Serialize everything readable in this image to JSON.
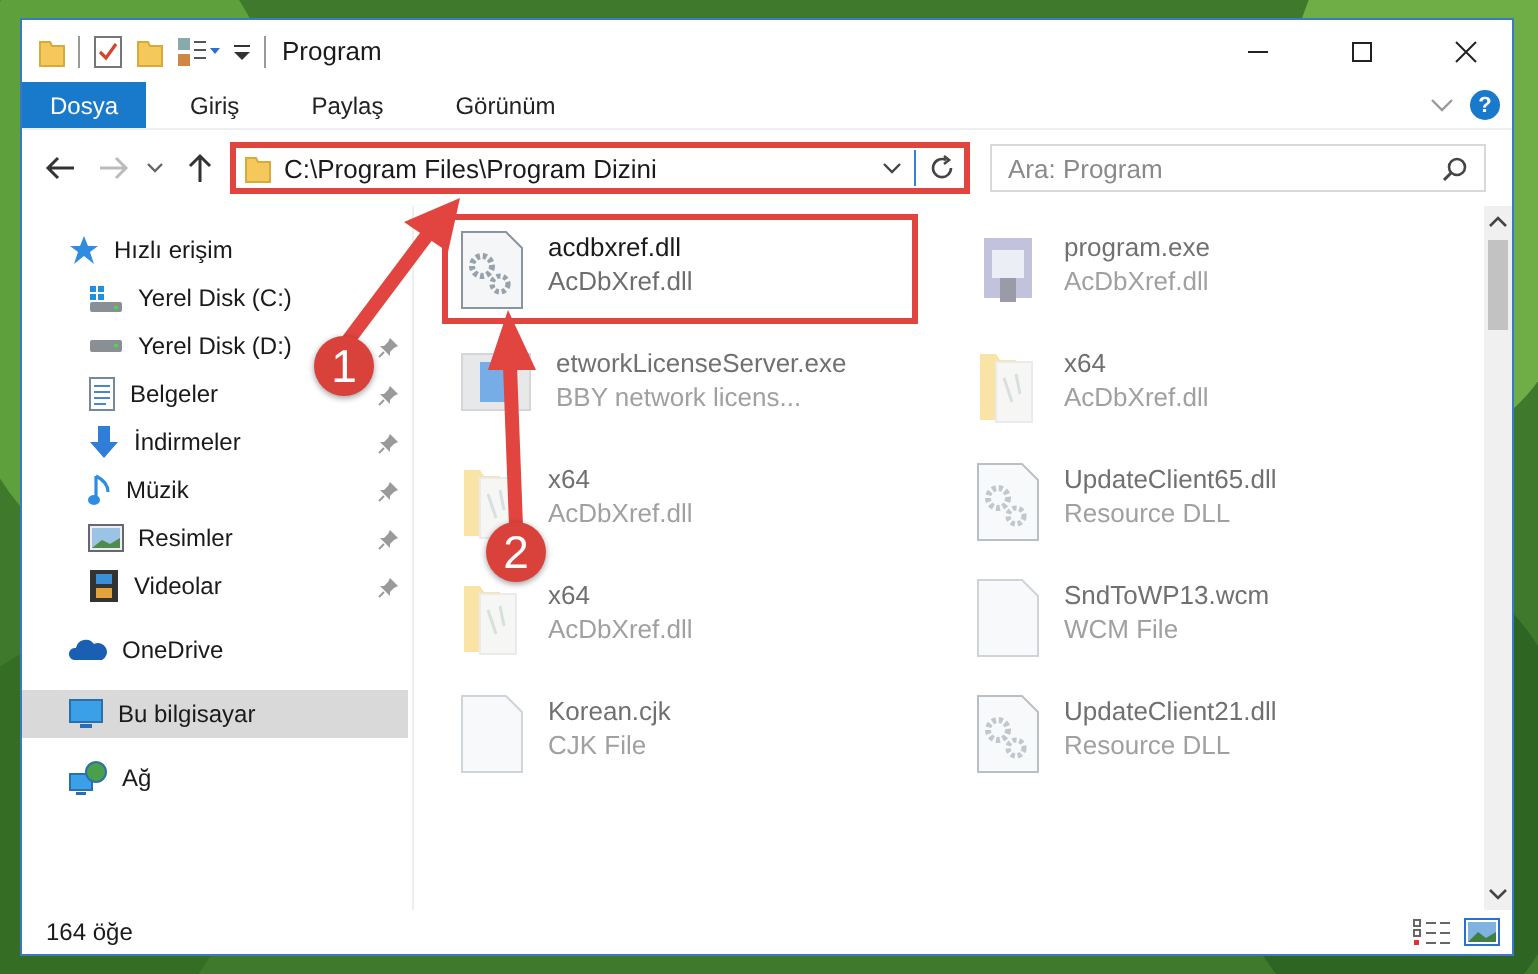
{
  "window": {
    "title": "Program"
  },
  "ribbon_tabs": [
    {
      "label": "Dosya",
      "selected": true
    },
    {
      "label": "Giriş",
      "selected": false
    },
    {
      "label": "Paylaş",
      "selected": false
    },
    {
      "label": "Görünüm",
      "selected": false
    }
  ],
  "help": "?",
  "address": {
    "path": "C:\\Program Files\\Program Dizini",
    "highlighted": true
  },
  "search": {
    "placeholder": "Ara: Program"
  },
  "navigation": [
    {
      "label": "Hızlı erişim",
      "kind": "star",
      "selected": false,
      "children": [
        {
          "label": "Yerel Disk (C:)",
          "kind": "windows-drive",
          "pinned": false,
          "selected": false
        },
        {
          "label": "Yerel Disk (D:)",
          "kind": "drive",
          "pinned": true,
          "selected": false
        },
        {
          "label": "Belgeler",
          "kind": "document",
          "pinned": true,
          "selected": false
        },
        {
          "label": "İndirmeler",
          "kind": "download",
          "pinned": true,
          "selected": false
        },
        {
          "label": "Müzik",
          "kind": "music",
          "pinned": true,
          "selected": false
        },
        {
          "label": "Resimler",
          "pinned": true,
          "selected": false
        },
        {
          "label": "Videolar",
          "kind": "film",
          "pinned": true,
          "selected": false
        }
      ]
    },
    {
      "label": "OneDrive",
      "kind": "cloud",
      "selected": false
    },
    {
      "label": "Bu bilgisayar",
      "kind": "monitor",
      "selected": true
    },
    {
      "label": "Ağ",
      "kind": "network",
      "selected": false
    }
  ],
  "files": [
    {
      "name": "acdbxref.dll",
      "type": "AcDbXref.dll",
      "kind": "gear-file",
      "highlighted": true,
      "faded": false
    },
    {
      "name": "program.exe",
      "type": "AcDbXref.dll",
      "kind": "program",
      "highlighted": false,
      "faded": true
    },
    {
      "name": "etworkLicenseServer.exe",
      "type": "BBY network licens...",
      "kind": "window-app",
      "highlighted": false,
      "faded": true
    },
    {
      "name": "x64",
      "type": "AcDbXref.dll",
      "kind": "folder",
      "highlighted": false,
      "faded": true
    },
    {
      "name": "x64",
      "type": "AcDbXref.dll",
      "kind": "folder",
      "highlighted": false,
      "faded": true
    },
    {
      "name": "UpdateClient65.dll",
      "type": "Resource DLL",
      "kind": "gear-file",
      "highlighted": false,
      "faded": true
    },
    {
      "name": "x64",
      "type": "AcDbXref.dll",
      "kind": "folder",
      "highlighted": false,
      "faded": true
    },
    {
      "name": "SndToWP13.wcm",
      "type": "WCM File",
      "kind": "blank-file",
      "highlighted": false,
      "faded": true
    },
    {
      "name": "Korean.cjk",
      "type": "CJK File",
      "kind": "blank-file",
      "highlighted": false,
      "faded": true
    },
    {
      "name": "UpdateClient21.dll",
      "type": "Resource DLL",
      "kind": "gear-file",
      "highlighted": false,
      "faded": true
    }
  ],
  "status_bar": {
    "item_count": "164 öğe"
  },
  "callouts": [
    {
      "number": "1"
    },
    {
      "number": "2"
    }
  ]
}
